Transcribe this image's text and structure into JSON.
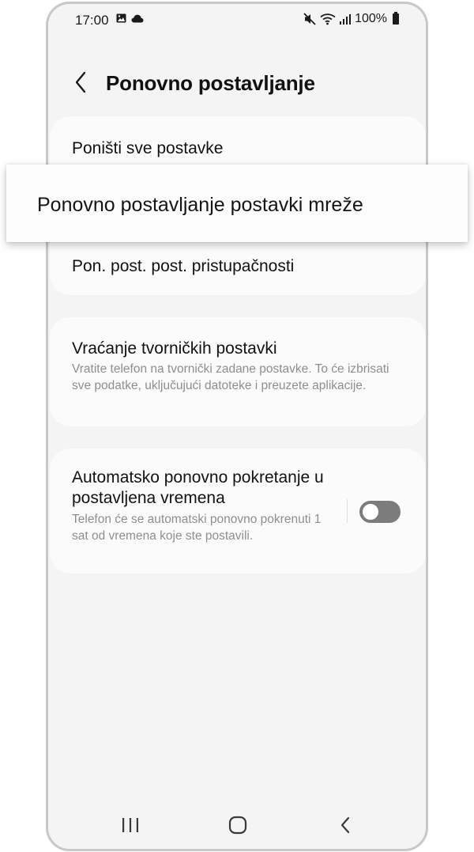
{
  "status_bar": {
    "time": "17:00",
    "battery": "100%",
    "icons": [
      "gallery-icon",
      "cloud-icon",
      "mute-icon",
      "wifi-icon",
      "signal-icon",
      "battery-icon"
    ]
  },
  "header": {
    "title": "Ponovno postavljanje",
    "back_icon": "chevron-left-icon"
  },
  "settings": {
    "reset_all": {
      "title": "Poništi sve postavke"
    },
    "network_reset": {
      "title": "Ponovno postavljanje postavki mreže"
    },
    "accessibility_reset": {
      "title": "Pon. post. post. pristupačnosti"
    },
    "factory_reset": {
      "title": "Vraćanje tvorničkih postavki",
      "subtitle": "Vratite telefon na tvornički zadane postavke. To će izbrisati sve podatke, uključujući datoteke i preuzete aplikacije."
    },
    "auto_restart": {
      "title": "Automatsko ponovno pokretanje u postavljena vremena",
      "subtitle": "Telefon će se automatski ponovno pokrenuti 1 sat od vremena koje ste postavili.",
      "enabled": false
    }
  },
  "nav_bar": {
    "icons": [
      "recent-apps-icon",
      "home-icon",
      "back-icon"
    ]
  },
  "colors": {
    "background": "#f4f4f4",
    "card": "#fbfbfb",
    "text": "#121212",
    "subtext": "#8e8e8e",
    "toggle_off": "#7c7c7c"
  }
}
